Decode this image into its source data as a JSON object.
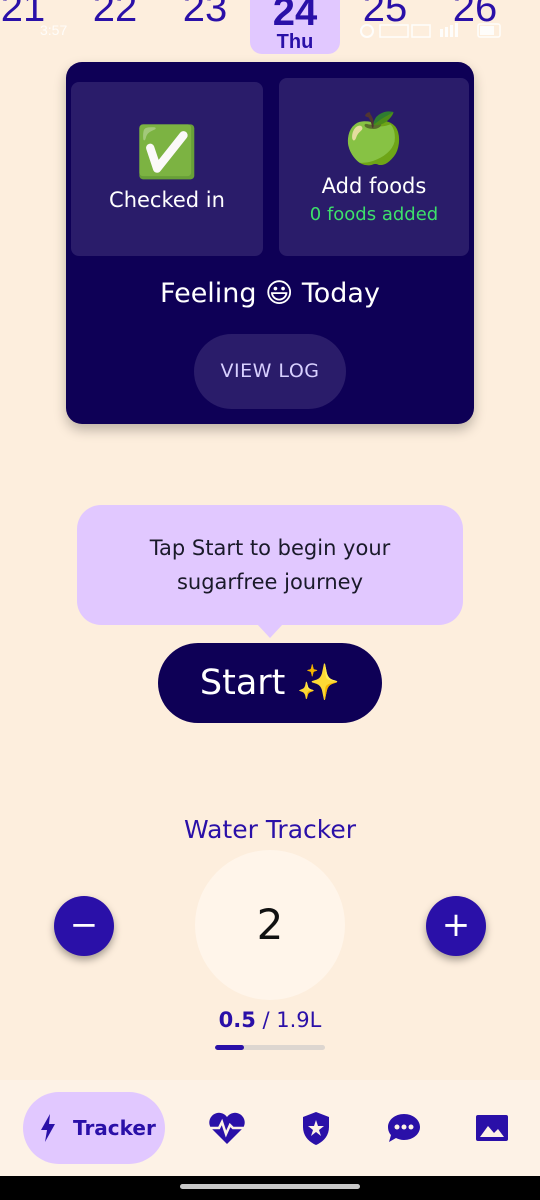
{
  "status_bar": {
    "time": "3:57"
  },
  "date_strip": {
    "days": [
      "21",
      "22",
      "23",
      "24",
      "25",
      "26"
    ],
    "selected_day": "24",
    "selected_weekday": "Thu"
  },
  "summary_card": {
    "checkin_emoji": "✅",
    "checkin_label": "Checked in",
    "foods_emoji": "🍏",
    "foods_label": "Add foods",
    "foods_count": "0 foods added",
    "feeling": "Feeling 😃 Today",
    "view_log_label": "VIEW LOG"
  },
  "tooltip": {
    "line1": "Tap Start to begin your",
    "line2": "sugarfree journey"
  },
  "start_button": {
    "label": "Start ✨"
  },
  "water_tracker": {
    "title": "Water Tracker",
    "count": "2",
    "consumed": "0.5",
    "goal": " / 1.9L",
    "progress_fraction": 0.26,
    "minus_label": "−",
    "plus_label": "+"
  },
  "bottom_nav": {
    "active_label": "Tracker",
    "items": [
      "heart-pulse-icon",
      "shield-star-icon",
      "chat-icon",
      "gallery-icon"
    ]
  },
  "colors": {
    "background": "#fdeedd",
    "primary": "#2a10a8",
    "card": "#0e0056",
    "accent": "#e1c8ff",
    "success": "#3de06a"
  }
}
